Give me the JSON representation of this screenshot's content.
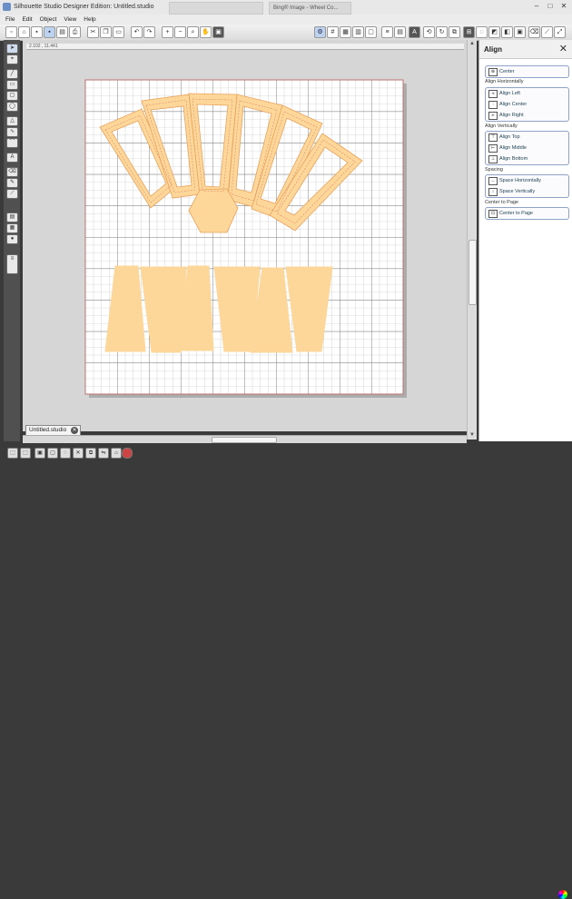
{
  "window": {
    "title": "Silhouette Studio Designer Edition: Untitled.studio",
    "ghost_tab_1": "",
    "ghost_tab_2": "Bing® Image - Wheel Co..."
  },
  "menu": [
    "File",
    "Edit",
    "Object",
    "View",
    "Help"
  ],
  "ruler": {
    "readout": "2.102 , 11.441"
  },
  "document_tab": {
    "label": "Untitled.studio"
  },
  "panel": {
    "title": "Align",
    "center_label": "Center",
    "sections": {
      "horizontal": "Align Horizontally",
      "vertical": "Align Vertically",
      "spacing": "Spacing",
      "center_page": "Center to Page"
    },
    "horizontal_buttons": [
      "Align Left",
      "Align Center",
      "Align Right"
    ],
    "vertical_buttons": [
      "Align Top",
      "Align Middle",
      "Align Bottom"
    ],
    "spacing_buttons": [
      "Space Horizontally",
      "Space Vertically"
    ],
    "center_page_button": "Center to Page"
  },
  "colors": {
    "shape_fill": "#fdd69a",
    "shape_stroke": "#e8a25c",
    "cut_line": "#e08f6a",
    "page_border": "#c07070"
  }
}
